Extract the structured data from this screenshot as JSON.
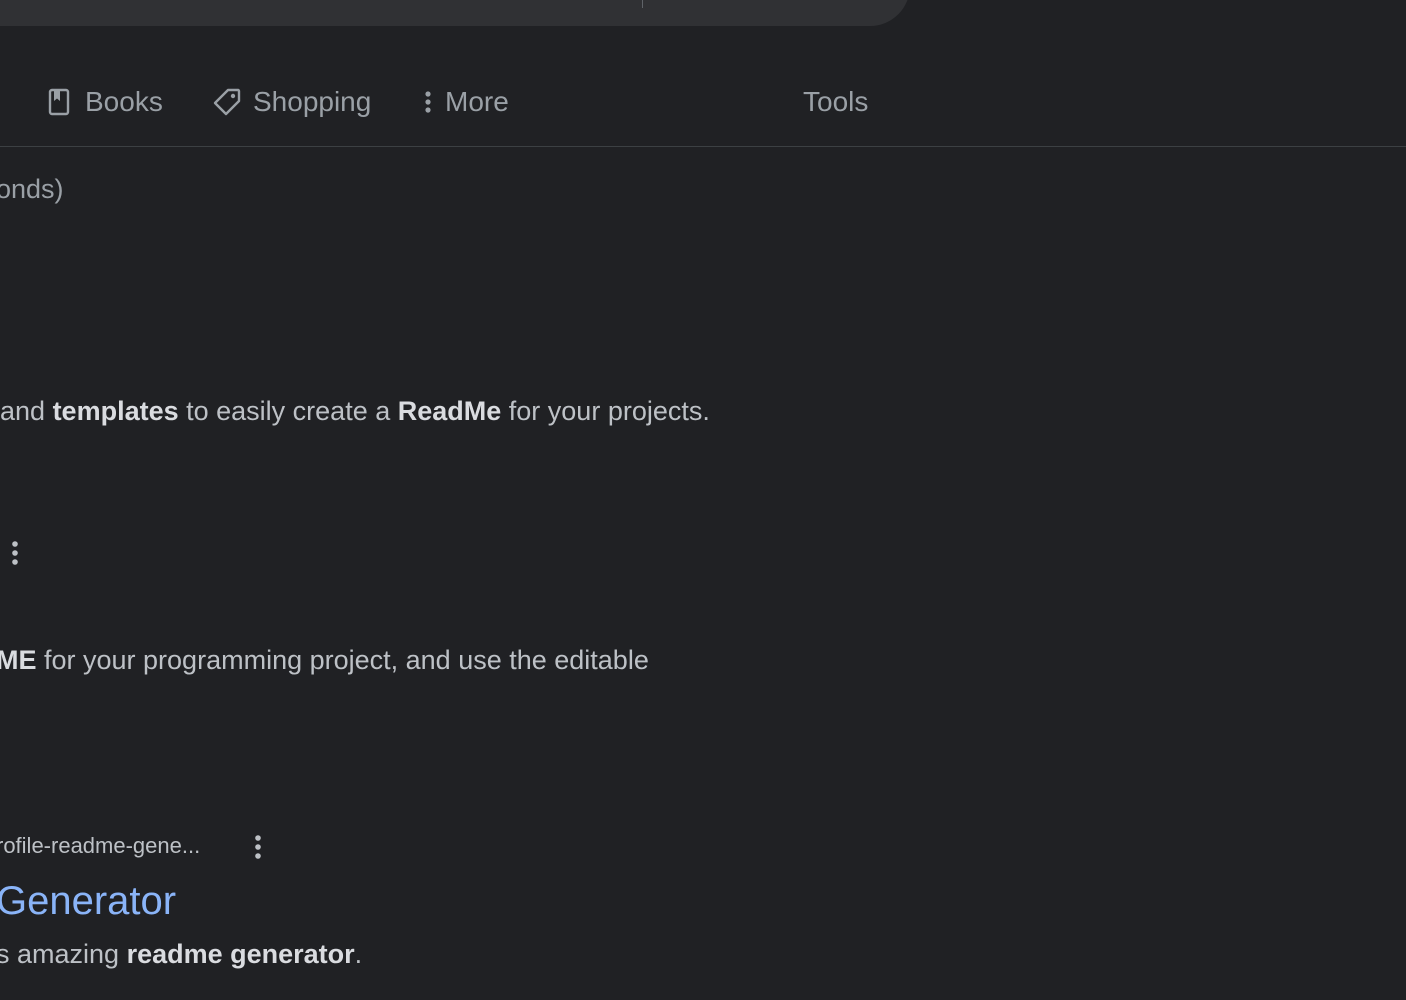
{
  "tabs": {
    "books": {
      "label": "Books",
      "icon": "book-icon"
    },
    "shopping": {
      "label": "Shopping",
      "icon": "tag-icon"
    },
    "more": {
      "label": "More",
      "icon": "vertical-dots-icon"
    },
    "tools": {
      "label": "Tools"
    }
  },
  "stats": {
    "text": "onds)"
  },
  "results": [
    {
      "snippet": {
        "prefix": "and ",
        "bold1": "templates",
        "mid": " to easily create a ",
        "bold2": "ReadMe",
        "suffix": " for your projects."
      }
    },
    {
      "snippet": {
        "bold1": "ME",
        "suffix": " for your programming project, and use the editable"
      }
    },
    {
      "cite": "rofile-readme-gene...",
      "title": "Generator",
      "snippet": {
        "prefix": "s amazing ",
        "bold1": "readme generator",
        "suffix": "."
      }
    }
  ],
  "colors": {
    "background": "#202124",
    "link": "#8ab4f8",
    "text": "#bdc1c6",
    "muted": "#9aa0a6"
  }
}
